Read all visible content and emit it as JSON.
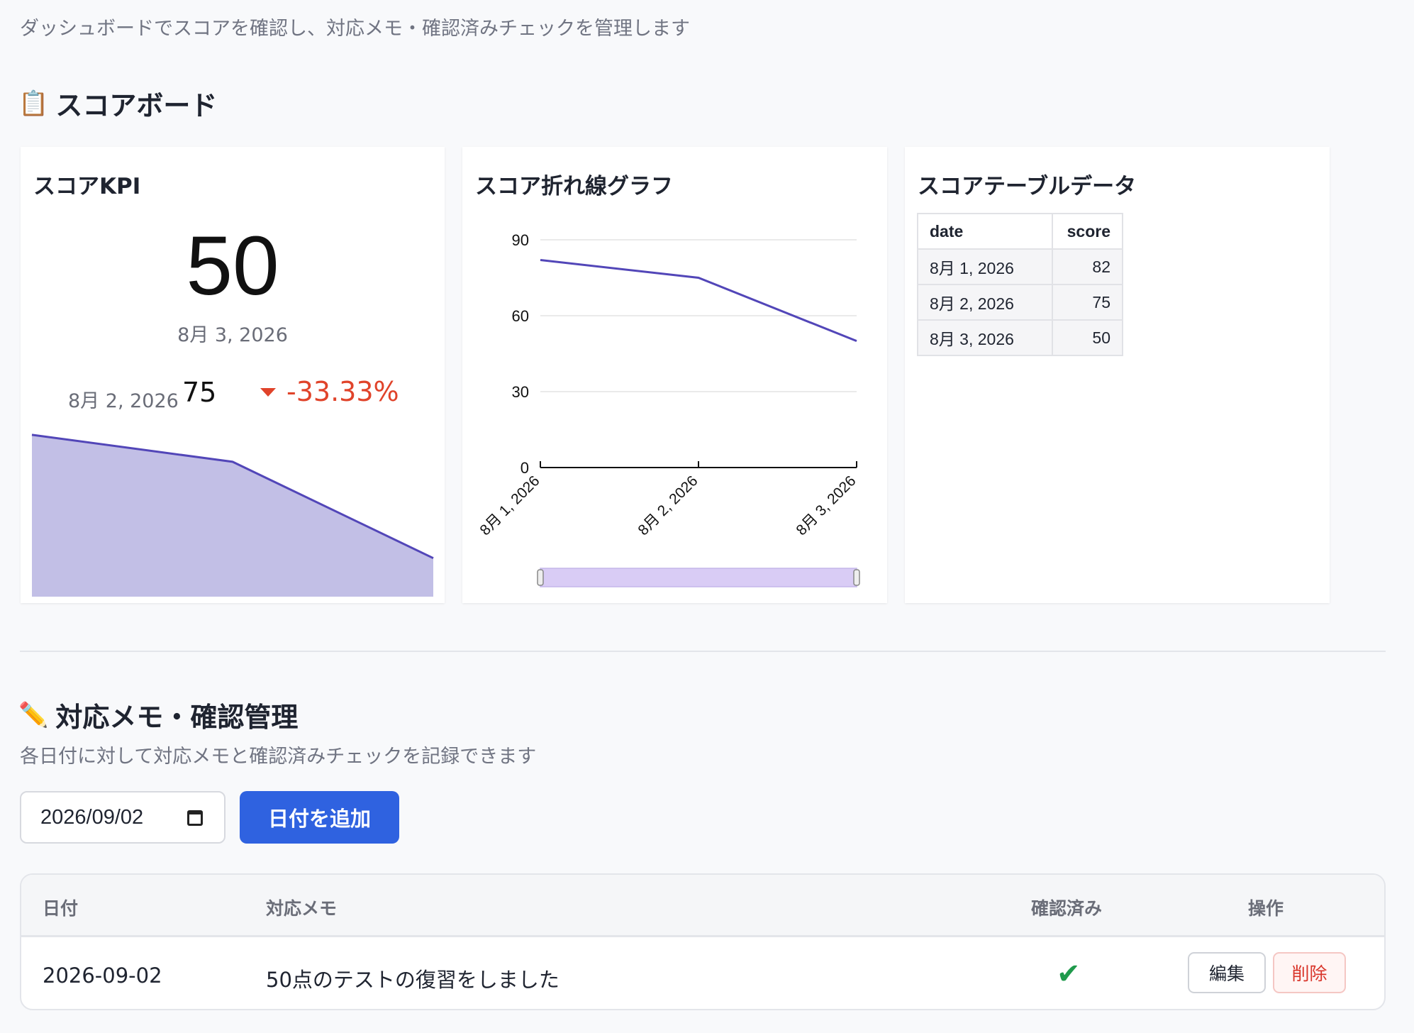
{
  "page": {
    "subtitle": "ダッシュボードでスコアを確認し、対応メモ・確認済みチェックを管理します"
  },
  "scoreboard": {
    "icon": "clipboard-icon",
    "emoji": "📋",
    "heading": "スコアボード"
  },
  "kpi": {
    "title": "スコアKPI",
    "value": "50",
    "date": "8月 3, 2026",
    "prev_date": "8月 2, 2026",
    "prev_value": "75",
    "delta": "-33.33%",
    "delta_color": "#e0432a",
    "spark_values": [
      82,
      75,
      50
    ]
  },
  "line_chart": {
    "title": "スコア折れ線グラフ",
    "color": "#5246b8",
    "chart_data": {
      "type": "line",
      "categories": [
        "8月 1, 2026",
        "8月 2, 2026",
        "8月 3, 2026"
      ],
      "values": [
        82,
        75,
        50
      ],
      "yticks": [
        "0",
        "30",
        "60",
        "90"
      ],
      "ylim": [
        0,
        90
      ],
      "grid": true
    }
  },
  "table": {
    "title": "スコアテーブルデータ",
    "headers": [
      "date",
      "score"
    ],
    "rows": [
      [
        "8月 1, 2026",
        "82"
      ],
      [
        "8月 2, 2026",
        "75"
      ],
      [
        "8月 3, 2026",
        "50"
      ]
    ]
  },
  "memo": {
    "emoji": "✏️",
    "icon": "pencil-icon",
    "heading": "対応メモ・確認管理",
    "subtitle": "各日付に対して対応メモと確認済みチェックを記録できます",
    "date_value": "2026/09/02",
    "add_button": "日付を追加",
    "columns": [
      "日付",
      "対応メモ",
      "確認済み",
      "操作"
    ],
    "rows": [
      {
        "date": "2026-09-02",
        "memo": "50点のテストの復習をしました",
        "checked": "✔",
        "edit": "編集",
        "delete": "削除"
      }
    ]
  }
}
